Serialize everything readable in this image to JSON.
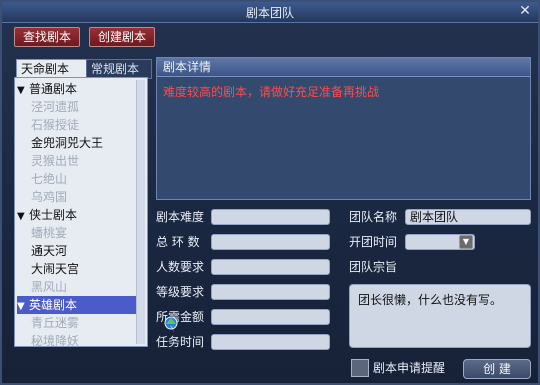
{
  "window": {
    "title": "剧本团队",
    "close_glyph": "✕"
  },
  "top_tabs": {
    "find": "查找剧本",
    "create": "创建剧本"
  },
  "left_tabs": {
    "active": "天命剧本",
    "inactive": "常规剧本"
  },
  "tree": [
    {
      "type": "category",
      "label": "普通剧本",
      "state": "expanded"
    },
    {
      "type": "item",
      "label": "泾河遗孤",
      "enabled": false
    },
    {
      "type": "item",
      "label": "石猴授徒",
      "enabled": false
    },
    {
      "type": "item",
      "label": "金兜洞兕大王",
      "enabled": true
    },
    {
      "type": "item",
      "label": "灵猴出世",
      "enabled": false
    },
    {
      "type": "item",
      "label": "七绝山",
      "enabled": false
    },
    {
      "type": "item",
      "label": "乌鸡国",
      "enabled": false
    },
    {
      "type": "category",
      "label": "侠士剧本",
      "state": "expanded"
    },
    {
      "type": "item",
      "label": "蟠桃宴",
      "enabled": false
    },
    {
      "type": "item",
      "label": "通天河",
      "enabled": true
    },
    {
      "type": "item",
      "label": "大闹天宫",
      "enabled": true
    },
    {
      "type": "item",
      "label": "黑风山",
      "enabled": false
    },
    {
      "type": "category",
      "label": "英雄剧本",
      "state": "expanded",
      "selected": true
    },
    {
      "type": "item",
      "label": "青丘迷雾",
      "enabled": false
    },
    {
      "type": "item",
      "label": "秘境降妖",
      "enabled": false
    }
  ],
  "detail": {
    "header": "剧本详情",
    "text": "难度较高的剧本，请做好充足准备再挑战"
  },
  "form": {
    "difficulty": "剧本难度",
    "rings": "总 环 数",
    "people": "人数要求",
    "level": "等级要求",
    "money": "所需金额",
    "time": "任务时间",
    "team_name_label": "团队名称",
    "team_name_value": "剧本团队",
    "open_time_label": "开团时间",
    "motto_label": "团队宗旨",
    "motto_value": "团长很懒，什么也没有写。",
    "remind_label": "剧本申请提醒",
    "create_button": "创 建"
  }
}
